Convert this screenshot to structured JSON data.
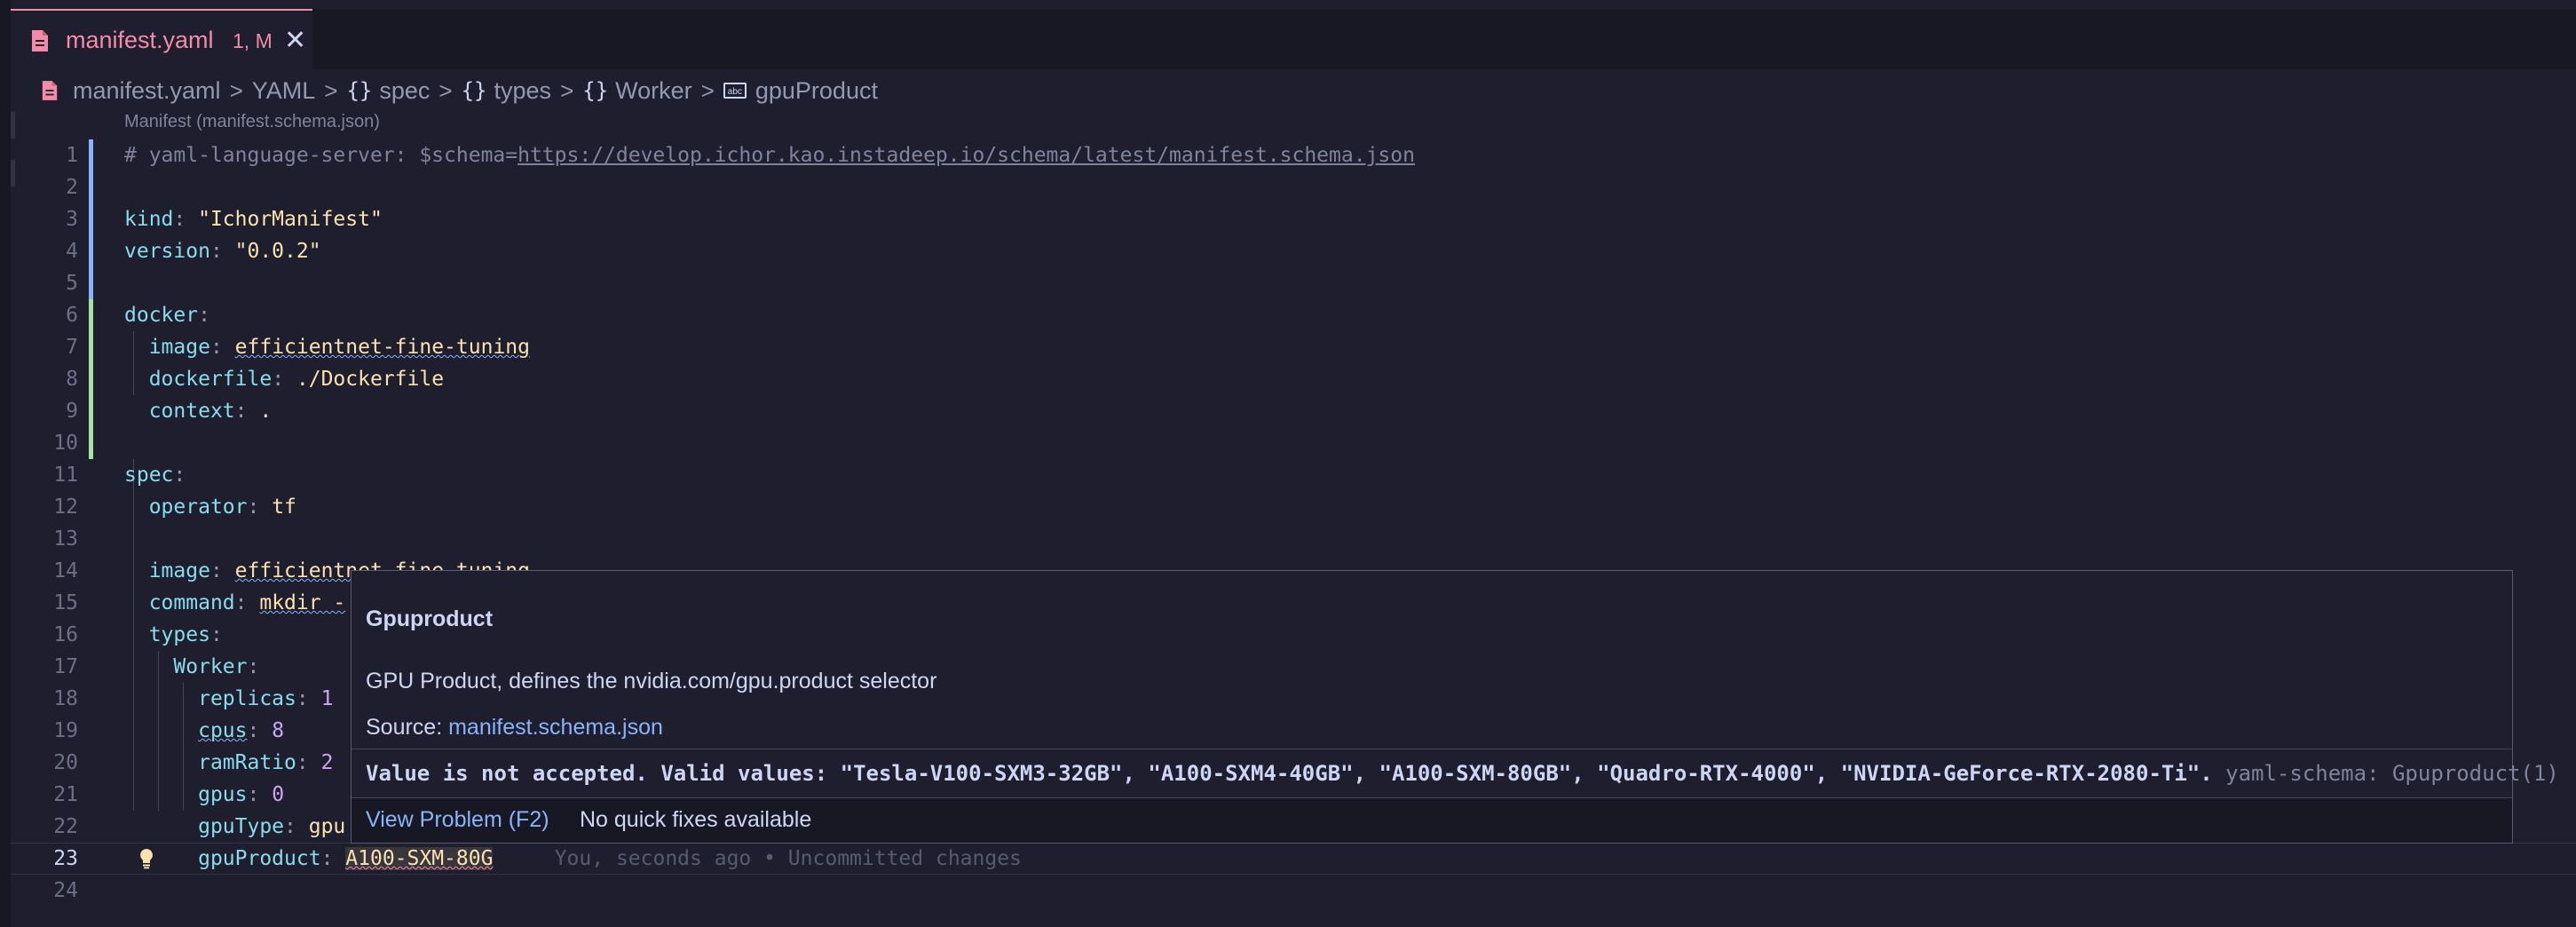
{
  "tab": {
    "title": "manifest.yaml",
    "status": "1, M",
    "close": "✕"
  },
  "breadcrumb": {
    "file": "manifest.yaml",
    "yaml": "YAML",
    "spec": "spec",
    "types": "types",
    "worker": "Worker",
    "field": "gpuProduct",
    "object_glyph": "{}"
  },
  "codelens": "Manifest (manifest.schema.json)",
  "lines": {
    "l1_comment": "# yaml-language-server: $schema=",
    "l1_url": "https://develop.ichor.kao.instadeep.io/schema/latest/manifest.schema.json",
    "l3_key": "kind",
    "l3_val": "\"IchorManifest\"",
    "l4_key": "version",
    "l4_val": "\"0.0.2\"",
    "l6_key": "docker",
    "l7_key": "image",
    "l7_val": "efficientnet-fine-tuning",
    "l8_key": "dockerfile",
    "l8_val": "./Dockerfile",
    "l9_key": "context",
    "l9_val": ".",
    "l11_key": "spec",
    "l12_key": "operator",
    "l12_val": "tf",
    "l14_key": "image",
    "l14_val": "efficientnet-fine-tuning",
    "l15_key": "command",
    "l15_val": "mkdir -",
    "l16_key": "types",
    "l17_key": "Worker",
    "l18_key": "replicas",
    "l18_val": "1",
    "l19_key": "cpus",
    "l19_val": "8",
    "l20_key": "ramRatio",
    "l20_val": "2",
    "l21_key": "gpus",
    "l21_val": "0",
    "l22_key": "gpuType",
    "l22_val": "gpu",
    "l23_key": "gpuProduct",
    "l23_val": "A100-SXM-80G",
    "l23_blame": "You, seconds ago • Uncommitted changes"
  },
  "line_numbers": [
    "1",
    "2",
    "3",
    "4",
    "5",
    "6",
    "7",
    "8",
    "9",
    "10",
    "11",
    "12",
    "13",
    "14",
    "15",
    "16",
    "17",
    "18",
    "19",
    "20",
    "21",
    "22",
    "23",
    "24"
  ],
  "hover": {
    "title": "Gpuproduct",
    "description": "GPU Product, defines the nvidia.com/gpu.product selector",
    "source_label": "Source: ",
    "source_link": "manifest.schema.json",
    "problem": "Value is not accepted. Valid values: \"Tesla-V100-SXM3-32GB\", \"A100-SXM4-40GB\", \"A100-SXM-80GB\", \"Quadro-RTX-4000\", \"NVIDIA-GeForce-RTX-2080-Ti\".",
    "problem_source": " yaml-schema: Gpuproduct(1)",
    "view_problem": "View Problem (F2)",
    "no_fixes": "No quick fixes available"
  },
  "colors": {
    "error": "#f38ba8",
    "key": "#89dceb",
    "string": "#f9e2af",
    "number": "#cba6f7",
    "link": "#89b4fa",
    "git_added": "#a6e3a1"
  },
  "icons": {
    "file": "yaml-file-icon",
    "bulb": "lightbulb-icon",
    "close": "close-icon",
    "abc": "string-symbol-icon"
  }
}
